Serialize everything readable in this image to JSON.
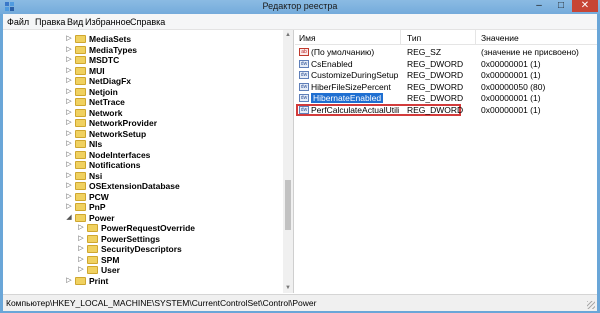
{
  "window": {
    "title": "Редактор реестра",
    "controls": {
      "minimize": "–",
      "maximize": "□",
      "close": "✕"
    }
  },
  "menu": [
    "Файл",
    "Правка",
    "Вид",
    "Избранное",
    "Справка"
  ],
  "tree": [
    {
      "label": "MediaSets",
      "level": 0,
      "expanded": false
    },
    {
      "label": "MediaTypes",
      "level": 0,
      "expanded": false
    },
    {
      "label": "MSDTC",
      "level": 0,
      "expanded": false
    },
    {
      "label": "MUI",
      "level": 0,
      "expanded": false
    },
    {
      "label": "NetDiagFx",
      "level": 0,
      "expanded": false
    },
    {
      "label": "Netjoin",
      "level": 0,
      "expanded": false
    },
    {
      "label": "NetTrace",
      "level": 0,
      "expanded": false
    },
    {
      "label": "Network",
      "level": 0,
      "expanded": false
    },
    {
      "label": "NetworkProvider",
      "level": 0,
      "expanded": false
    },
    {
      "label": "NetworkSetup",
      "level": 0,
      "expanded": false
    },
    {
      "label": "Nls",
      "level": 0,
      "expanded": false
    },
    {
      "label": "NodeInterfaces",
      "level": 0,
      "expanded": false
    },
    {
      "label": "Notifications",
      "level": 0,
      "expanded": false
    },
    {
      "label": "Nsi",
      "level": 0,
      "expanded": false
    },
    {
      "label": "OSExtensionDatabase",
      "level": 0,
      "expanded": false
    },
    {
      "label": "PCW",
      "level": 0,
      "expanded": false
    },
    {
      "label": "PnP",
      "level": 0,
      "expanded": false
    },
    {
      "label": "Power",
      "level": 0,
      "expanded": true
    },
    {
      "label": "PowerRequestOverride",
      "level": 1,
      "expanded": false
    },
    {
      "label": "PowerSettings",
      "level": 1,
      "expanded": false
    },
    {
      "label": "SecurityDescriptors",
      "level": 1,
      "expanded": false
    },
    {
      "label": "SPM",
      "level": 1,
      "expanded": false
    },
    {
      "label": "User",
      "level": 1,
      "expanded": false
    },
    {
      "label": "Print",
      "level": 0,
      "expanded": false
    }
  ],
  "list": {
    "columns": [
      "Имя",
      "Тип",
      "Значение"
    ],
    "rows": [
      {
        "icon": "ab",
        "name": "(По умолчанию)",
        "type": "REG_SZ",
        "value": "(значение не присвоено)"
      },
      {
        "icon": "dw",
        "name": "CsEnabled",
        "type": "REG_DWORD",
        "value": "0x00000001 (1)"
      },
      {
        "icon": "dw",
        "name": "CustomizeDuringSetup",
        "type": "REG_DWORD",
        "value": "0x00000001 (1)"
      },
      {
        "icon": "dw",
        "name": "HiberFileSizePercent",
        "type": "REG_DWORD",
        "value": "0x00000050 (80)"
      },
      {
        "icon": "dw",
        "name": "HibernateEnabled",
        "type": "REG_DWORD",
        "value": "0x00000001 (1)",
        "selected": true
      },
      {
        "icon": "dw",
        "name": "PerfCalculateActualUtilizat...",
        "type": "REG_DWORD",
        "value": "0x00000001 (1)"
      }
    ]
  },
  "status": "Компьютер\\HKEY_LOCAL_MACHINE\\SYSTEM\\CurrentControlSet\\Control\\Power",
  "colors": {
    "selection": "#1f6fd1",
    "highlight_box": "#d23b3b",
    "close_button": "#c74535"
  }
}
